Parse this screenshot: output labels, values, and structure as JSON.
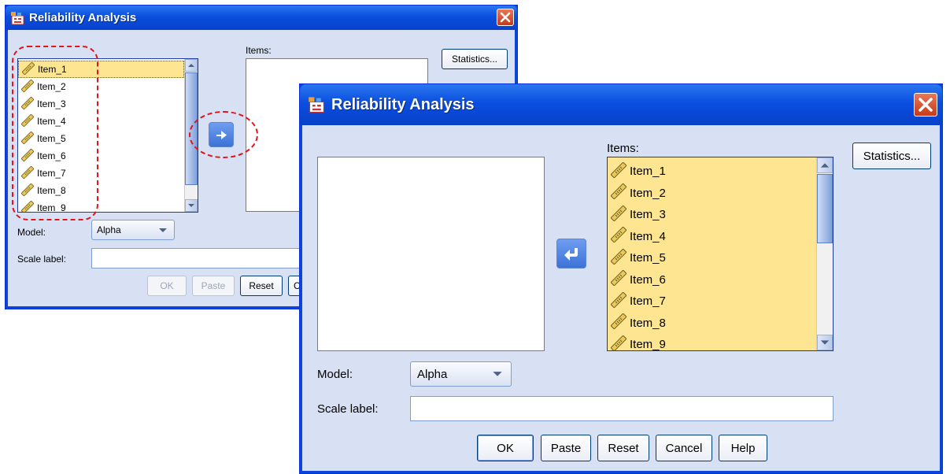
{
  "back_dialog": {
    "title": "Reliability Analysis",
    "source_items": [
      "Item_1",
      "Item_2",
      "Item_3",
      "Item_4",
      "Item_5",
      "Item_6",
      "Item_7",
      "Item_8",
      "Item_9"
    ],
    "highlighted_item": "Item_1",
    "items_label": "Items:",
    "statistics_label": "Statistics...",
    "model_label": "Model:",
    "model_value": "Alpha",
    "scale_label": "Scale label:",
    "scale_value": "",
    "buttons": {
      "ok": "OK",
      "paste": "Paste",
      "reset": "Reset",
      "cancel": "C"
    }
  },
  "front_dialog": {
    "title": "Reliability Analysis",
    "items_label": "Items:",
    "target_items": [
      "Item_1",
      "Item_2",
      "Item_3",
      "Item_4",
      "Item_5",
      "Item_6",
      "Item_7",
      "Item_8",
      "Item_9"
    ],
    "statistics_label": "Statistics...",
    "model_label": "Model:",
    "model_value": "Alpha",
    "scale_label": "Scale label:",
    "scale_value": "",
    "buttons": {
      "ok": "OK",
      "paste": "Paste",
      "reset": "Reset",
      "cancel": "Cancel",
      "help": "Help"
    }
  },
  "colors": {
    "titlebar": "#0a4ee0",
    "client_bg": "#d7e1f3",
    "selection": "#fde592",
    "annotation": "#e5131b"
  },
  "icons": {
    "item_icon": "ruler-icon",
    "move_right": "arrow-right-icon",
    "move_left": "arrow-left-icon"
  }
}
